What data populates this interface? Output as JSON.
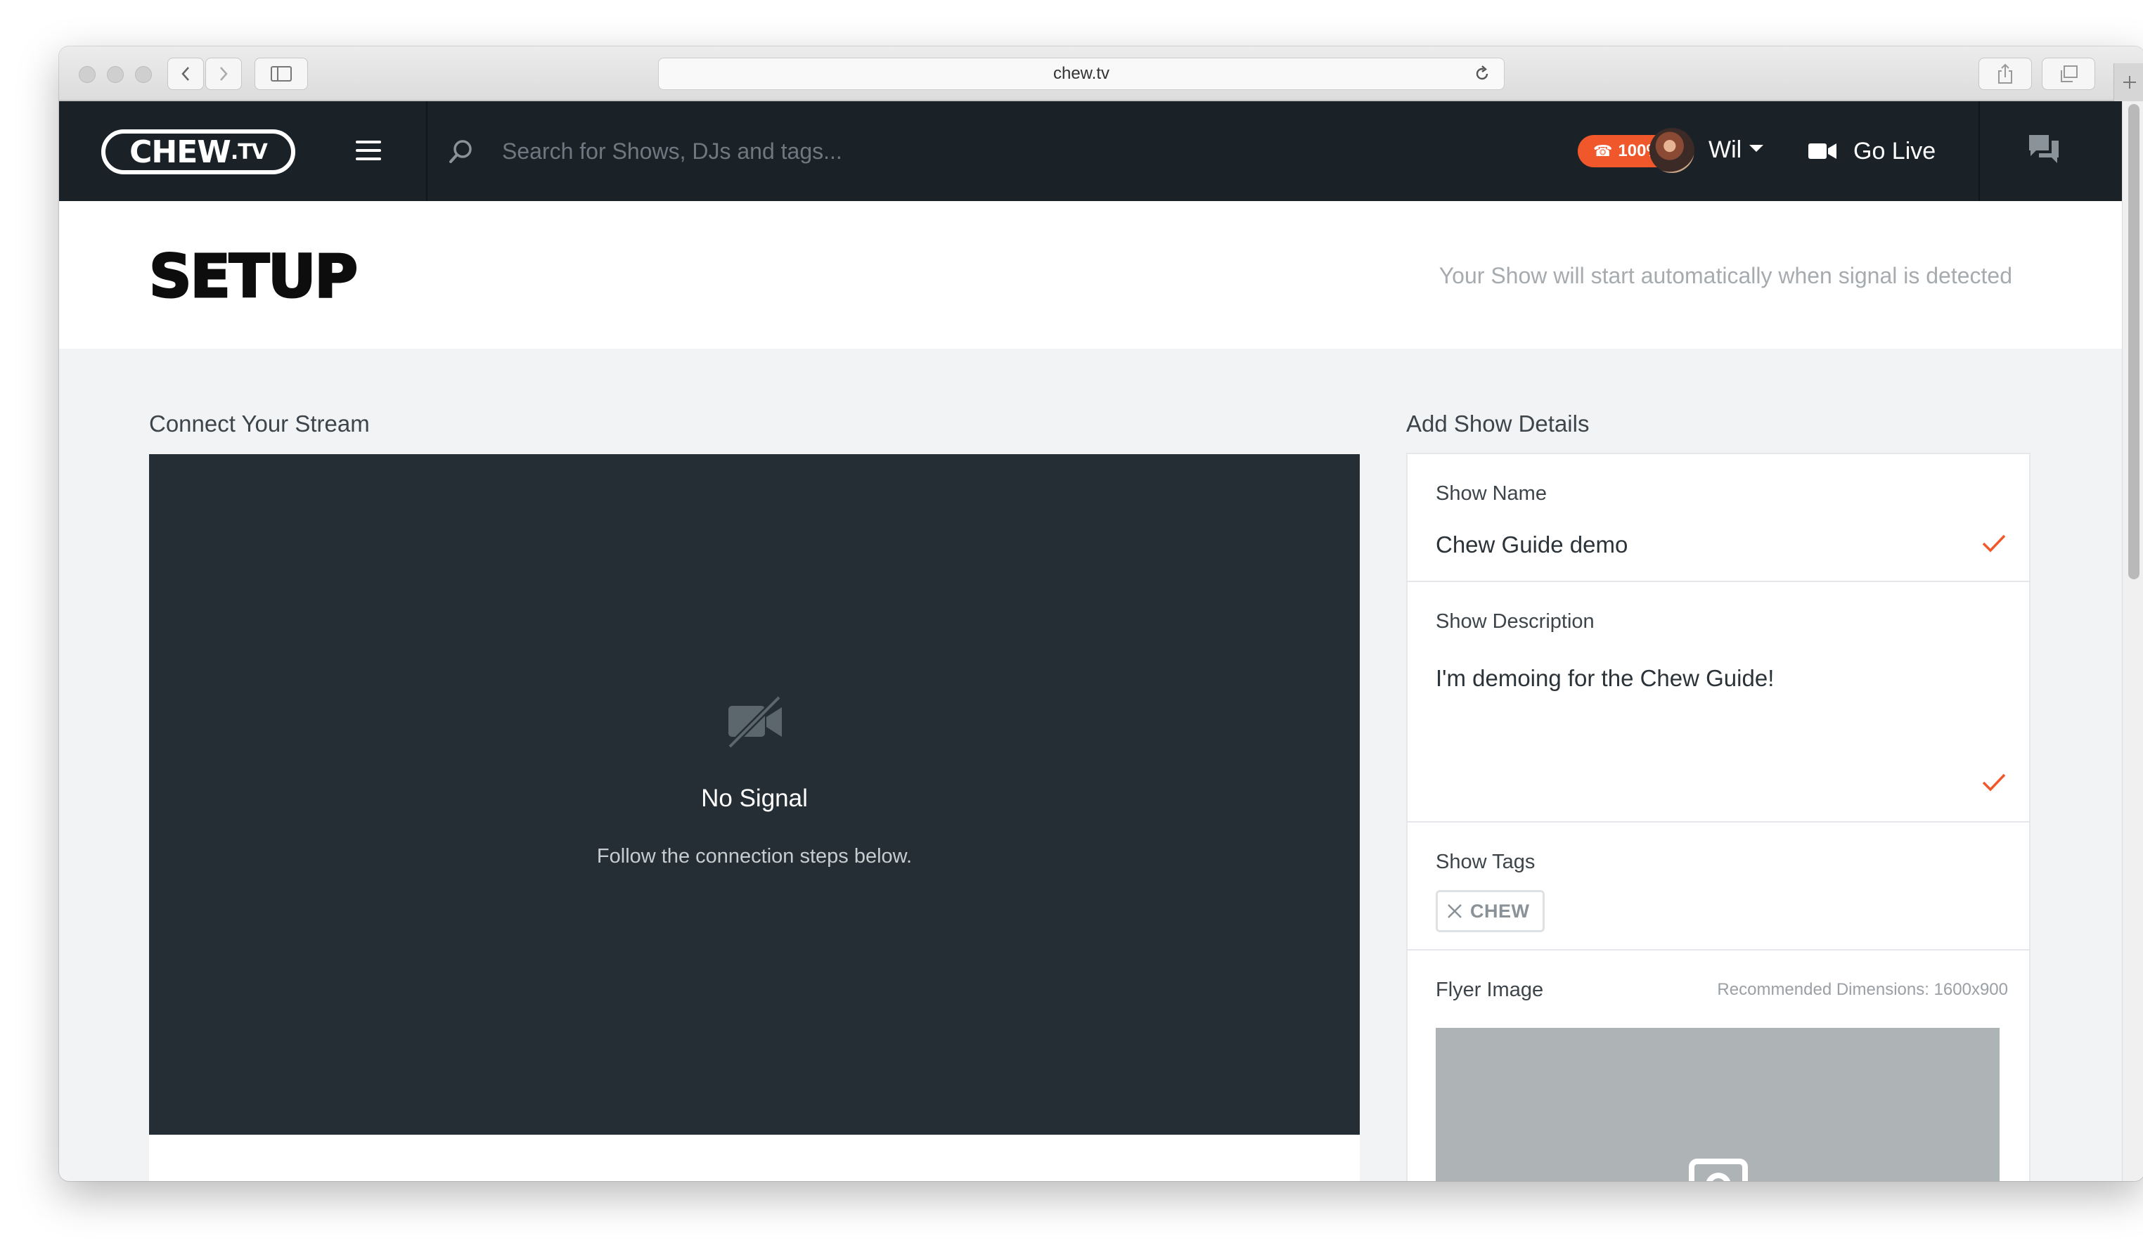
{
  "browser": {
    "url": "chew.tv"
  },
  "header": {
    "logo_text": "CHEW",
    "logo_suffix": ".TV",
    "search_placeholder": "Search for Shows, DJs and tags...",
    "battery_label": "100%",
    "user_name": "Wil",
    "go_live_label": "Go Live",
    "accent_color": "#f0582b"
  },
  "setup": {
    "title": "SETUP",
    "hint": "Your Show will start automatically when signal is detected"
  },
  "stream": {
    "section_title": "Connect Your Stream",
    "status_title": "No Signal",
    "status_subtitle": "Follow the connection steps below."
  },
  "details": {
    "section_title": "Add Show Details",
    "show_name_label": "Show Name",
    "show_name_value": "Chew Guide demo",
    "show_description_label": "Show Description",
    "show_description_value": "I'm demoing for the Chew Guide!",
    "show_tags_label": "Show Tags",
    "tags": [
      "CHEW"
    ],
    "flyer_label": "Flyer Image",
    "flyer_hint": "Recommended Dimensions: 1600x900"
  }
}
